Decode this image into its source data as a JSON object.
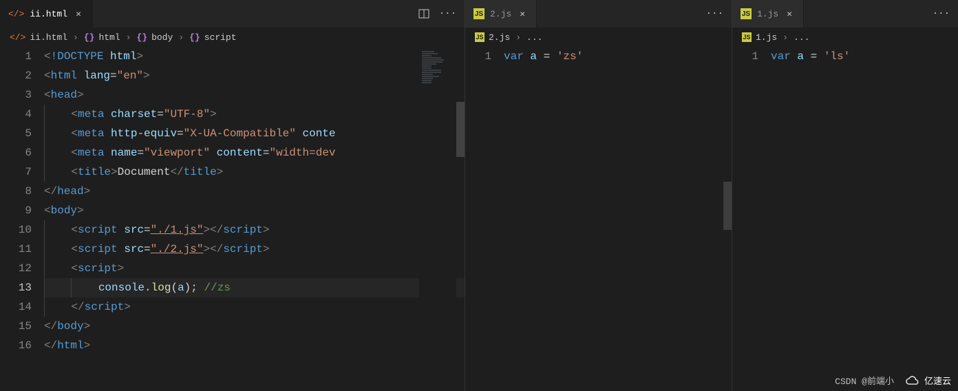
{
  "panes": [
    {
      "tab": {
        "icon": "html",
        "label": "ii.html",
        "active": true
      },
      "actions": [
        "split",
        "more"
      ],
      "breadcrumb": [
        {
          "icon": "html",
          "label": "ii.html"
        },
        {
          "icon": "brackets",
          "label": "html"
        },
        {
          "icon": "brackets",
          "label": "body"
        },
        {
          "icon": "brackets",
          "label": "script"
        }
      ],
      "active_line": 13,
      "lines": [
        {
          "n": 1,
          "tokens": [
            [
              "punct",
              "<"
            ],
            [
              "doctype",
              "!DOCTYPE "
            ],
            [
              "attr",
              "html"
            ],
            [
              "punct",
              ">"
            ]
          ]
        },
        {
          "n": 2,
          "tokens": [
            [
              "punct",
              "<"
            ],
            [
              "tag",
              "html "
            ],
            [
              "attr",
              "lang"
            ],
            [
              "txt",
              "="
            ],
            [
              "str",
              "\"en\""
            ],
            [
              "punct",
              ">"
            ]
          ]
        },
        {
          "n": 3,
          "tokens": [
            [
              "punct",
              "<"
            ],
            [
              "tag",
              "head"
            ],
            [
              "punct",
              ">"
            ]
          ]
        },
        {
          "n": 4,
          "indent": 1,
          "tokens": [
            [
              "punct",
              "<"
            ],
            [
              "tag",
              "meta "
            ],
            [
              "attr",
              "charset"
            ],
            [
              "txt",
              "="
            ],
            [
              "str",
              "\"UTF-8\""
            ],
            [
              "punct",
              ">"
            ]
          ]
        },
        {
          "n": 5,
          "indent": 1,
          "tokens": [
            [
              "punct",
              "<"
            ],
            [
              "tag",
              "meta "
            ],
            [
              "attr",
              "http-equiv"
            ],
            [
              "txt",
              "="
            ],
            [
              "str",
              "\"X-UA-Compatible\" "
            ],
            [
              "attr",
              "conte"
            ]
          ]
        },
        {
          "n": 6,
          "indent": 1,
          "tokens": [
            [
              "punct",
              "<"
            ],
            [
              "tag",
              "meta "
            ],
            [
              "attr",
              "name"
            ],
            [
              "txt",
              "="
            ],
            [
              "str",
              "\"viewport\" "
            ],
            [
              "attr",
              "content"
            ],
            [
              "txt",
              "="
            ],
            [
              "str",
              "\"width=dev"
            ]
          ]
        },
        {
          "n": 7,
          "indent": 1,
          "tokens": [
            [
              "punct",
              "<"
            ],
            [
              "tag",
              "title"
            ],
            [
              "punct",
              ">"
            ],
            [
              "txt",
              "Document"
            ],
            [
              "punct",
              "</"
            ],
            [
              "tag",
              "title"
            ],
            [
              "punct",
              ">"
            ]
          ]
        },
        {
          "n": 8,
          "tokens": [
            [
              "punct",
              "</"
            ],
            [
              "tag",
              "head"
            ],
            [
              "punct",
              ">"
            ]
          ]
        },
        {
          "n": 9,
          "tokens": [
            [
              "punct",
              "<"
            ],
            [
              "tag",
              "body"
            ],
            [
              "punct",
              ">"
            ]
          ]
        },
        {
          "n": 10,
          "indent": 1,
          "tokens": [
            [
              "punct",
              "<"
            ],
            [
              "tag",
              "script "
            ],
            [
              "attr",
              "src"
            ],
            [
              "txt",
              "="
            ],
            [
              "stru",
              "\"./1.js\""
            ],
            [
              "punct",
              "></"
            ],
            [
              "tag",
              "script"
            ],
            [
              "punct",
              ">"
            ]
          ]
        },
        {
          "n": 11,
          "indent": 1,
          "tokens": [
            [
              "punct",
              "<"
            ],
            [
              "tag",
              "script "
            ],
            [
              "attr",
              "src"
            ],
            [
              "txt",
              "="
            ],
            [
              "stru",
              "\"./2.js\""
            ],
            [
              "punct",
              "></"
            ],
            [
              "tag",
              "script"
            ],
            [
              "punct",
              ">"
            ]
          ]
        },
        {
          "n": 12,
          "indent": 1,
          "tokens": [
            [
              "punct",
              "<"
            ],
            [
              "tag",
              "script"
            ],
            [
              "punct",
              ">"
            ]
          ]
        },
        {
          "n": 13,
          "indent": 2,
          "tokens": [
            [
              "id",
              "console"
            ],
            [
              "txt",
              "."
            ],
            [
              "fn",
              "log"
            ],
            [
              "txt",
              "("
            ],
            [
              "id",
              "a"
            ],
            [
              "txt",
              "); "
            ],
            [
              "comment",
              "//zs"
            ]
          ]
        },
        {
          "n": 14,
          "indent": 1,
          "tokens": [
            [
              "punct",
              "</"
            ],
            [
              "tag",
              "script"
            ],
            [
              "punct",
              ">"
            ]
          ]
        },
        {
          "n": 15,
          "tokens": [
            [
              "punct",
              "</"
            ],
            [
              "tag",
              "body"
            ],
            [
              "punct",
              ">"
            ]
          ]
        },
        {
          "n": 16,
          "tokens": [
            [
              "punct",
              "</"
            ],
            [
              "tag",
              "html"
            ],
            [
              "punct",
              ">"
            ]
          ]
        }
      ]
    },
    {
      "tab": {
        "icon": "js",
        "label": "2.js",
        "active": false
      },
      "actions": [
        "more"
      ],
      "breadcrumb": [
        {
          "icon": "js",
          "label": "2.js"
        },
        {
          "icon": "",
          "label": "..."
        }
      ],
      "lines": [
        {
          "n": 1,
          "tokens": [
            [
              "kw",
              "var "
            ],
            [
              "id",
              "a"
            ],
            [
              "txt",
              " = "
            ],
            [
              "str",
              "'zs'"
            ]
          ]
        }
      ]
    },
    {
      "tab": {
        "icon": "js",
        "label": "1.js",
        "active": false
      },
      "actions": [
        "more"
      ],
      "breadcrumb": [
        {
          "icon": "js",
          "label": "1.js"
        },
        {
          "icon": "",
          "label": "..."
        }
      ],
      "lines": [
        {
          "n": 1,
          "tokens": [
            [
              "kw",
              "var "
            ],
            [
              "id",
              "a"
            ],
            [
              "txt",
              " = "
            ],
            [
              "str",
              "'ls'"
            ]
          ]
        }
      ]
    }
  ],
  "footer": {
    "watermark": "CSDN @前端小",
    "logo": "亿速云"
  }
}
